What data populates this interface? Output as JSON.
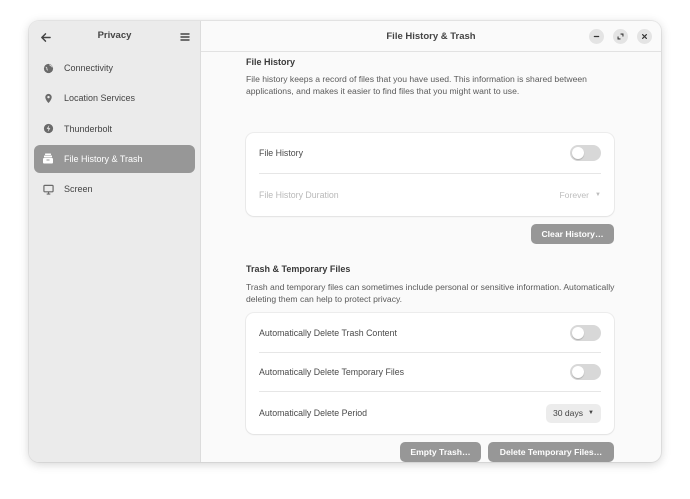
{
  "sidebar": {
    "title": "Privacy",
    "items": [
      {
        "label": "Connectivity",
        "icon": "globe-icon"
      },
      {
        "label": "Location Services",
        "icon": "location-pin-icon"
      },
      {
        "label": "Thunderbolt",
        "icon": "thunderbolt-icon"
      },
      {
        "label": "File History & Trash",
        "icon": "file-history-icon",
        "active": true
      },
      {
        "label": "Screen",
        "icon": "monitor-icon"
      }
    ]
  },
  "header": {
    "title": "File History & Trash"
  },
  "file_history": {
    "title": "File History",
    "description": "File history keeps a record of files that you have used. This information is shared between applications, and makes it easier to find files that you might want to use.",
    "toggle_label": "File History",
    "toggle_on": false,
    "duration_label": "File History Duration",
    "duration_value": "Forever",
    "clear_button": "Clear History…"
  },
  "trash": {
    "title": "Trash & Temporary Files",
    "description": "Trash and temporary files can sometimes include personal or sensitive information. Automatically deleting them can help to protect privacy.",
    "auto_trash_label": "Automatically Delete Trash Content",
    "auto_trash_on": false,
    "auto_temp_label": "Automatically Delete Temporary Files",
    "auto_temp_on": false,
    "period_label": "Automatically Delete Period",
    "period_value": "30 days",
    "empty_button": "Empty Trash…",
    "delete_temp_button": "Delete Temporary Files…"
  },
  "colors": {
    "accent": "#979797",
    "sidebar_bg": "#ebebeb",
    "window_bg": "#fafafa"
  }
}
